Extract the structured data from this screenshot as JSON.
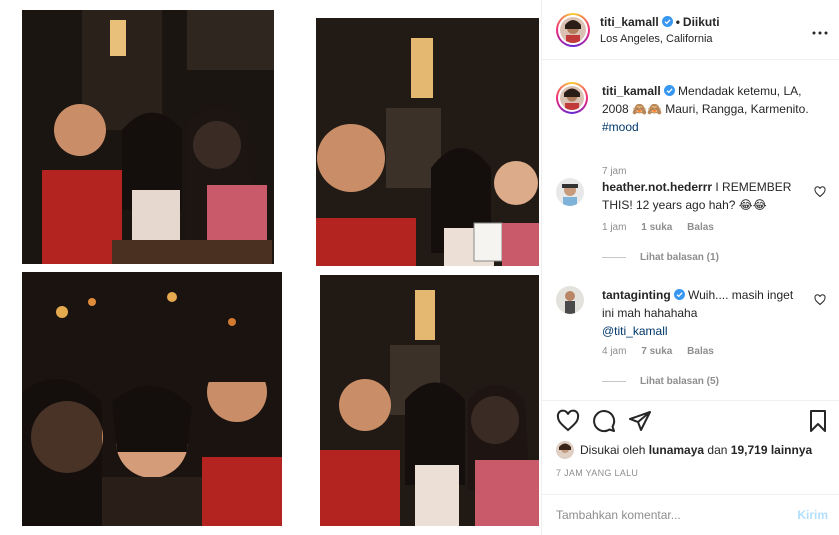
{
  "post": {
    "author": {
      "username": "titi_kamall",
      "verified": true,
      "follow_status": "Diikuti",
      "location": "Los Angeles, California"
    },
    "caption": {
      "username": "titi_kamall",
      "text": "Mendadak ketemu, LA, 2008 🙈🙈 Mauri, Rangga, Karmenito.",
      "hashtag": "#mood",
      "time": "7 jam"
    },
    "comments": [
      {
        "username": "heather.not.hederrr",
        "verified": false,
        "text": "I REMEMBER THIS! 12 years ago hah? 😂😂",
        "time": "1 jam",
        "likes": "1 suka",
        "reply": "Balas",
        "view_replies": "Lihat balasan (1)"
      },
      {
        "username": "tantaginting",
        "verified": true,
        "text": "Wuih.... masih inget ini mah hahahaha",
        "mention": "@titi_kamall",
        "time": "4 jam",
        "likes": "7 suka",
        "reply": "Balas",
        "view_replies": "Lihat balasan (5)"
      }
    ],
    "liked_by": {
      "prefix": "Disukai oleh",
      "user": "lunamaya",
      "connector": "dan",
      "count": "19,719 lainnya"
    },
    "timestamp": "7 JAM YANG LALU",
    "comment_box": {
      "placeholder": "Tambahkan komentar...",
      "send_label": "Kirim"
    },
    "icons": [
      "heart-icon",
      "comment-icon",
      "share-icon",
      "bookmark-icon",
      "more-icon",
      "verified-badge-icon"
    ],
    "colors": {
      "verified": "#3897f0",
      "link": "#00376b",
      "muted": "#8e8e8e",
      "send_disabled": "#b2dffc"
    }
  }
}
